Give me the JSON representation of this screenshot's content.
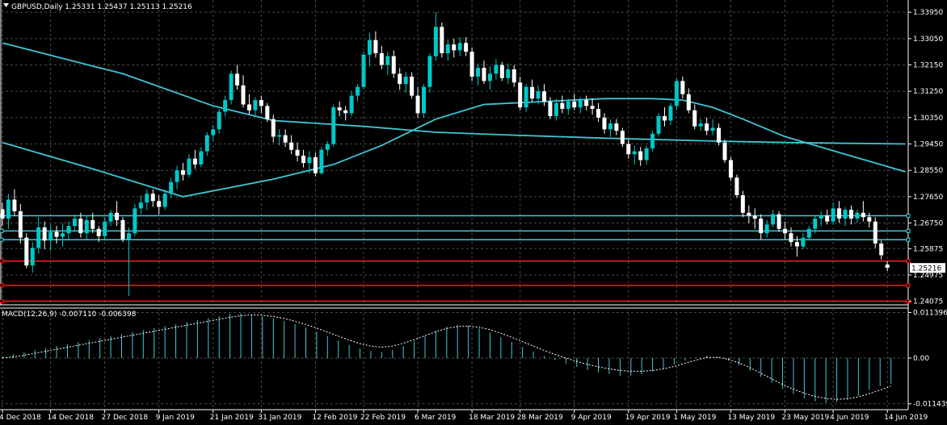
{
  "header": {
    "title": "GBPUSD,Daily  1.25331 1.25437 1.25113 1.25216",
    "menu_icon": "triangle-down-icon"
  },
  "macd": {
    "label": "MACD(12,26,9) -0.007110 -0.006398",
    "axis_labels": [
      "0.011396",
      "0.00",
      "-0.011439"
    ],
    "axis_values": [
      0.011396,
      0.0,
      -0.011439
    ],
    "hist": [
      0.0005,
      0.001,
      0.0015,
      0.002,
      0.0025,
      0.003,
      0.0035,
      0.004,
      0.0045,
      0.005,
      0.0055,
      0.006,
      0.0065,
      0.007,
      0.0075,
      0.008,
      0.0085,
      0.009,
      0.0095,
      0.01,
      0.0105,
      0.011,
      0.0112,
      0.0109,
      0.0105,
      0.01,
      0.0093,
      0.0085,
      0.0076,
      0.0066,
      0.0055,
      0.0044,
      0.0033,
      0.0024,
      0.0018,
      0.0015,
      0.002,
      0.003,
      0.0042,
      0.0055,
      0.0068,
      0.0078,
      0.0083,
      0.0081,
      0.0074,
      0.0064,
      0.0052,
      0.004,
      0.0028,
      0.0016,
      0.0005,
      -0.0005,
      -0.0014,
      -0.0022,
      -0.003,
      -0.0036,
      -0.004,
      -0.0044,
      -0.0044,
      -0.004,
      -0.0034,
      -0.0026,
      -0.0016,
      -0.0006,
      0.0002,
      0.0006,
      0.0003,
      -0.0006,
      -0.0018,
      -0.0032,
      -0.0047,
      -0.0062,
      -0.0077,
      -0.009,
      -0.0101,
      -0.0108,
      -0.0112,
      -0.011,
      -0.0104,
      -0.0094,
      -0.008,
      -0.007,
      -0.0064
    ],
    "signal": [
      0.0,
      0.0003,
      0.0007,
      0.0012,
      0.0017,
      0.0022,
      0.0027,
      0.0032,
      0.0037,
      0.0042,
      0.0047,
      0.0052,
      0.0057,
      0.0062,
      0.0067,
      0.0072,
      0.0077,
      0.0082,
      0.0087,
      0.0092,
      0.0097,
      0.0102,
      0.0106,
      0.0108,
      0.0107,
      0.0104,
      0.0099,
      0.0092,
      0.0084,
      0.0075,
      0.0065,
      0.0055,
      0.0045,
      0.0036,
      0.003,
      0.0027,
      0.003,
      0.0037,
      0.0046,
      0.0056,
      0.0066,
      0.0074,
      0.0079,
      0.008,
      0.0077,
      0.0071,
      0.0062,
      0.0052,
      0.0041,
      0.003,
      0.0019,
      0.0009,
      0.0,
      -0.0008,
      -0.0016,
      -0.0022,
      -0.0027,
      -0.0031,
      -0.0033,
      -0.0033,
      -0.0031,
      -0.0027,
      -0.0021,
      -0.0013,
      -0.0005,
      0.0001,
      0.0002,
      -0.0003,
      -0.0012,
      -0.0024,
      -0.0038,
      -0.0052,
      -0.0066,
      -0.0078,
      -0.0088,
      -0.0096,
      -0.0101,
      -0.0103,
      -0.0102,
      -0.0097,
      -0.0089,
      -0.008,
      -0.007
    ]
  },
  "price_axis": {
    "labels": [
      "1.33950",
      "1.33050",
      "1.32150",
      "1.31250",
      "1.30350",
      "1.29450",
      "1.28550",
      "1.27650",
      "1.26750",
      "1.25875",
      "1.24975",
      "1.24075"
    ],
    "values": [
      1.3395,
      1.3305,
      1.3215,
      1.3125,
      1.3035,
      1.2945,
      1.2855,
      1.2765,
      1.2675,
      1.25875,
      1.24975,
      1.24075
    ],
    "current_price": "1.25216",
    "current_value": 1.25216
  },
  "time_axis": {
    "labels": [
      "4 Dec 2018",
      "14 Dec 2018",
      "27 Dec 2018",
      "9 Jan 2019",
      "21 Jan 2019",
      "31 Jan 2019",
      "12 Feb 2019",
      "22 Feb 2019",
      "6 Mar 2019",
      "18 Mar 2019",
      "28 Mar 2019",
      "9 Apr 2019",
      "19 Apr 2019",
      "1 May 2019",
      "13 May 2019",
      "23 May 2019",
      "4 Jun 2019",
      "14 Jun 2019"
    ],
    "slots": [
      0,
      8,
      17,
      26,
      35,
      43,
      52,
      60,
      69,
      78,
      86,
      95,
      104,
      112,
      121,
      130,
      138,
      147
    ]
  },
  "levels": {
    "cyan": [
      1.27,
      1.2648,
      1.2618
    ],
    "red": [
      1.2545,
      1.2462,
      1.2408
    ]
  },
  "colors": {
    "background": "#000000",
    "grid": "#4a4a4a",
    "bull": "#00c8c8",
    "bear": "#ffffff",
    "ma": "#3fc6d6",
    "cyan_level": "#40c8d8",
    "red_level": "#ff1a1a",
    "macd_hist": "#40c8d8",
    "macd_signal": "#ffffff",
    "text": "#ffffff"
  },
  "chart_data": {
    "type": "candlestick",
    "symbol": "GBPUSD",
    "timeframe": "Daily",
    "ohlc_last": {
      "open": 1.25331,
      "high": 1.25437,
      "low": 1.25113,
      "close": 1.25216
    },
    "ylim": [
      1.239,
      1.3412
    ],
    "candles": [
      [
        1.2722,
        1.2745,
        1.2665,
        1.269
      ],
      [
        1.269,
        1.2775,
        1.2655,
        1.2755
      ],
      [
        1.2755,
        1.279,
        1.27,
        1.2715
      ],
      [
        1.2715,
        1.274,
        1.2605,
        1.2625
      ],
      [
        1.2625,
        1.264,
        1.252,
        1.253
      ],
      [
        1.253,
        1.261,
        1.2505,
        1.259
      ],
      [
        1.259,
        1.2695,
        1.257,
        1.266
      ],
      [
        1.266,
        1.268,
        1.2585,
        1.2615
      ],
      [
        1.2615,
        1.267,
        1.258,
        1.2645
      ],
      [
        1.2645,
        1.2665,
        1.2605,
        1.2628
      ],
      [
        1.2628,
        1.2675,
        1.2595,
        1.264
      ],
      [
        1.264,
        1.268,
        1.2615,
        1.2665
      ],
      [
        1.2665,
        1.2705,
        1.2645,
        1.269
      ],
      [
        1.269,
        1.271,
        1.2625,
        1.264
      ],
      [
        1.264,
        1.27,
        1.262,
        1.2685
      ],
      [
        1.2685,
        1.271,
        1.264,
        1.2655
      ],
      [
        1.2655,
        1.2665,
        1.261,
        1.263
      ],
      [
        1.263,
        1.2695,
        1.2615,
        1.268
      ],
      [
        1.268,
        1.272,
        1.2665,
        1.271
      ],
      [
        1.271,
        1.275,
        1.2665,
        1.2685
      ],
      [
        1.2685,
        1.2695,
        1.261,
        1.262
      ],
      [
        1.262,
        1.266,
        1.2425,
        1.264
      ],
      [
        1.264,
        1.274,
        1.263,
        1.2725
      ],
      [
        1.2725,
        1.277,
        1.2705,
        1.2745
      ],
      [
        1.2745,
        1.279,
        1.272,
        1.2775
      ],
      [
        1.2775,
        1.279,
        1.273,
        1.275
      ],
      [
        1.275,
        1.277,
        1.2705,
        1.273
      ],
      [
        1.273,
        1.279,
        1.272,
        1.2775
      ],
      [
        1.2775,
        1.283,
        1.276,
        1.2815
      ],
      [
        1.2815,
        1.287,
        1.279,
        1.2855
      ],
      [
        1.2855,
        1.288,
        1.282,
        1.284
      ],
      [
        1.284,
        1.291,
        1.283,
        1.2895
      ],
      [
        1.2895,
        1.2925,
        1.286,
        1.2875
      ],
      [
        1.2875,
        1.2935,
        1.2865,
        1.292
      ],
      [
        1.292,
        1.2985,
        1.2905,
        1.2975
      ],
      [
        1.2975,
        1.301,
        1.2955,
        1.2995
      ],
      [
        1.2995,
        1.3065,
        1.298,
        1.3055
      ],
      [
        1.3055,
        1.311,
        1.304,
        1.3095
      ],
      [
        1.3095,
        1.3195,
        1.308,
        1.3185
      ],
      [
        1.3185,
        1.3215,
        1.313,
        1.3145
      ],
      [
        1.3145,
        1.318,
        1.307,
        1.308
      ],
      [
        1.308,
        1.3115,
        1.3045,
        1.306
      ],
      [
        1.306,
        1.3105,
        1.304,
        1.3095
      ],
      [
        1.3095,
        1.311,
        1.305,
        1.3075
      ],
      [
        1.3075,
        1.3085,
        1.302,
        1.303
      ],
      [
        1.303,
        1.3045,
        1.295,
        1.297
      ],
      [
        1.297,
        1.2995,
        1.294,
        1.2975
      ],
      [
        1.2975,
        1.2995,
        1.2935,
        1.295
      ],
      [
        1.295,
        1.2975,
        1.291,
        1.2925
      ],
      [
        1.2925,
        1.295,
        1.2885,
        1.2905
      ],
      [
        1.2905,
        1.2925,
        1.2865,
        1.288
      ],
      [
        1.288,
        1.292,
        1.2845,
        1.29
      ],
      [
        1.29,
        1.2915,
        1.2835,
        1.2845
      ],
      [
        1.2845,
        1.2935,
        1.284,
        1.2925
      ],
      [
        1.2925,
        1.2955,
        1.2905,
        1.2945
      ],
      [
        1.2945,
        1.308,
        1.2935,
        1.307
      ],
      [
        1.307,
        1.309,
        1.304,
        1.306
      ],
      [
        1.306,
        1.3075,
        1.3025,
        1.305
      ],
      [
        1.305,
        1.3125,
        1.304,
        1.311
      ],
      [
        1.311,
        1.315,
        1.309,
        1.314
      ],
      [
        1.314,
        1.326,
        1.313,
        1.325
      ],
      [
        1.325,
        1.3325,
        1.321,
        1.33
      ],
      [
        1.33,
        1.333,
        1.324,
        1.3255
      ],
      [
        1.3255,
        1.328,
        1.32,
        1.3215
      ],
      [
        1.3215,
        1.326,
        1.318,
        1.3245
      ],
      [
        1.3245,
        1.3265,
        1.317,
        1.3185
      ],
      [
        1.3185,
        1.3205,
        1.313,
        1.315
      ],
      [
        1.315,
        1.319,
        1.312,
        1.3175
      ],
      [
        1.3175,
        1.319,
        1.31,
        1.311
      ],
      [
        1.311,
        1.314,
        1.3035,
        1.305
      ],
      [
        1.305,
        1.315,
        1.3035,
        1.314
      ],
      [
        1.314,
        1.3255,
        1.312,
        1.3245
      ],
      [
        1.3245,
        1.3395,
        1.323,
        1.3345
      ],
      [
        1.3345,
        1.336,
        1.324,
        1.3255
      ],
      [
        1.3255,
        1.33,
        1.323,
        1.3285
      ],
      [
        1.3285,
        1.3305,
        1.324,
        1.3265
      ],
      [
        1.3265,
        1.331,
        1.3245,
        1.329
      ],
      [
        1.329,
        1.331,
        1.3245,
        1.326
      ],
      [
        1.326,
        1.3275,
        1.316,
        1.3175
      ],
      [
        1.3175,
        1.322,
        1.3145,
        1.3205
      ],
      [
        1.3205,
        1.323,
        1.315,
        1.316
      ],
      [
        1.316,
        1.321,
        1.313,
        1.3185
      ],
      [
        1.3185,
        1.3235,
        1.3165,
        1.3215
      ],
      [
        1.3215,
        1.3225,
        1.316,
        1.317
      ],
      [
        1.317,
        1.322,
        1.315,
        1.32
      ],
      [
        1.32,
        1.3215,
        1.314,
        1.3155
      ],
      [
        1.3155,
        1.3175,
        1.306,
        1.307
      ],
      [
        1.307,
        1.315,
        1.3055,
        1.314
      ],
      [
        1.314,
        1.3165,
        1.309,
        1.31
      ],
      [
        1.31,
        1.3145,
        1.308,
        1.3125
      ],
      [
        1.3125,
        1.315,
        1.3075,
        1.309
      ],
      [
        1.309,
        1.3105,
        1.303,
        1.304
      ],
      [
        1.304,
        1.31,
        1.3025,
        1.3085
      ],
      [
        1.3085,
        1.311,
        1.305,
        1.3065
      ],
      [
        1.3065,
        1.31,
        1.3045,
        1.309
      ],
      [
        1.309,
        1.3115,
        1.306,
        1.307
      ],
      [
        1.307,
        1.3105,
        1.305,
        1.3095
      ],
      [
        1.3095,
        1.311,
        1.306,
        1.3075
      ],
      [
        1.3075,
        1.31,
        1.3045,
        1.3065
      ],
      [
        1.3065,
        1.3085,
        1.302,
        1.3035
      ],
      [
        1.3035,
        1.305,
        1.298,
        1.2995
      ],
      [
        1.2995,
        1.303,
        1.297,
        1.3015
      ],
      [
        1.3015,
        1.303,
        1.2975,
        1.299
      ],
      [
        1.299,
        1.3,
        1.2935,
        1.2945
      ],
      [
        1.2945,
        1.296,
        1.2895,
        1.291
      ],
      [
        1.291,
        1.294,
        1.2875,
        1.292
      ],
      [
        1.292,
        1.2935,
        1.287,
        1.289
      ],
      [
        1.289,
        1.294,
        1.2875,
        1.293
      ],
      [
        1.293,
        1.299,
        1.292,
        1.298
      ],
      [
        1.298,
        1.305,
        1.297,
        1.304
      ],
      [
        1.304,
        1.307,
        1.3005,
        1.3025
      ],
      [
        1.3025,
        1.3085,
        1.301,
        1.3075
      ],
      [
        1.3075,
        1.317,
        1.306,
        1.316
      ],
      [
        1.316,
        1.3175,
        1.31,
        1.3115
      ],
      [
        1.3115,
        1.3135,
        1.305,
        1.306
      ],
      [
        1.306,
        1.308,
        1.2995,
        1.3005
      ],
      [
        1.3005,
        1.303,
        1.299,
        1.3015
      ],
      [
        1.3015,
        1.3035,
        1.2975,
        1.299
      ],
      [
        1.299,
        1.303,
        1.2975,
        1.3
      ],
      [
        1.3,
        1.3015,
        1.294,
        1.295
      ],
      [
        1.295,
        1.296,
        1.288,
        1.289
      ],
      [
        1.289,
        1.29,
        1.282,
        1.283
      ],
      [
        1.283,
        1.284,
        1.276,
        1.277
      ],
      [
        1.277,
        1.2785,
        1.2695,
        1.271
      ],
      [
        1.271,
        1.2735,
        1.2675,
        1.27
      ],
      [
        1.27,
        1.2725,
        1.2655,
        1.269
      ],
      [
        1.269,
        1.2705,
        1.262,
        1.264
      ],
      [
        1.264,
        1.2685,
        1.2625,
        1.267
      ],
      [
        1.267,
        1.272,
        1.266,
        1.2705
      ],
      [
        1.2705,
        1.2715,
        1.2645,
        1.2655
      ],
      [
        1.2655,
        1.268,
        1.262,
        1.264
      ],
      [
        1.264,
        1.266,
        1.2595,
        1.261
      ],
      [
        1.261,
        1.263,
        1.256,
        1.2595
      ],
      [
        1.2595,
        1.264,
        1.2585,
        1.2625
      ],
      [
        1.2625,
        1.2665,
        1.2615,
        1.2655
      ],
      [
        1.2655,
        1.27,
        1.264,
        1.269
      ],
      [
        1.269,
        1.2715,
        1.2665,
        1.27
      ],
      [
        1.27,
        1.272,
        1.267,
        1.268
      ],
      [
        1.268,
        1.2745,
        1.267,
        1.2725
      ],
      [
        1.2725,
        1.275,
        1.2675,
        1.269
      ],
      [
        1.269,
        1.273,
        1.2665,
        1.272
      ],
      [
        1.272,
        1.2735,
        1.267,
        1.269
      ],
      [
        1.269,
        1.272,
        1.2675,
        1.271
      ],
      [
        1.271,
        1.275,
        1.268,
        1.2695
      ],
      [
        1.2695,
        1.271,
        1.266,
        1.268
      ],
      [
        1.268,
        1.2695,
        1.259,
        1.2605
      ],
      [
        1.2605,
        1.2615,
        1.255,
        1.2565
      ],
      [
        1.2533,
        1.2544,
        1.2511,
        1.2522
      ]
    ],
    "ma_fast": {
      "slot": [
        0,
        15,
        30,
        45,
        55,
        63,
        72,
        80,
        90,
        100,
        108,
        113,
        118,
        123,
        130,
        140,
        150
      ],
      "value": [
        1.295,
        1.286,
        1.2765,
        1.2825,
        1.2875,
        1.294,
        1.303,
        1.308,
        1.309,
        1.31,
        1.31,
        1.3095,
        1.307,
        1.303,
        1.297,
        1.291,
        1.285
      ]
    },
    "ma_slow": {
      "slot": [
        0,
        20,
        35,
        45,
        60,
        72,
        85,
        100,
        118,
        130,
        150
      ],
      "value": [
        1.329,
        1.3185,
        1.3075,
        1.3025,
        1.3005,
        1.2985,
        1.2975,
        1.2965,
        1.2955,
        1.295,
        1.2945
      ]
    }
  }
}
